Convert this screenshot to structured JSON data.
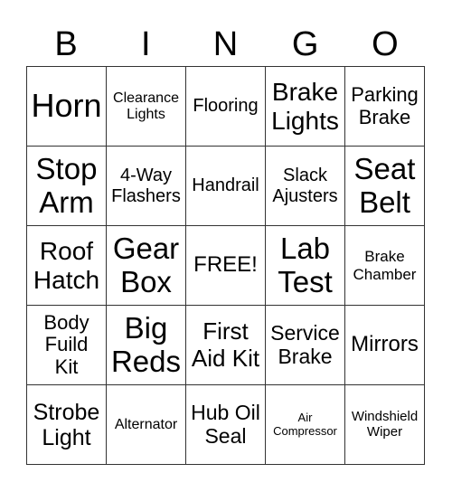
{
  "header": [
    "B",
    "I",
    "N",
    "G",
    "O"
  ],
  "cells": [
    "Horn",
    "Clearance\nLights",
    "Flooring",
    "Brake\nLights",
    "Parking\nBrake",
    "Stop\nArm",
    "4-Way\nFlashers",
    "Handrail",
    "Slack\nAjusters",
    "Seat\nBelt",
    "Roof\nHatch",
    "Gear\nBox",
    "FREE!",
    "Lab\nTest",
    "Brake\nChamber",
    "Body\nFuild\nKit",
    "Big\nReds",
    "First\nAid Kit",
    "Service\nBrake",
    "Mirrors",
    "Strobe\nLight",
    "Alternator",
    "Hub Oil\nSeal",
    "Air\nCompressor",
    "Windshield\nWiper"
  ]
}
